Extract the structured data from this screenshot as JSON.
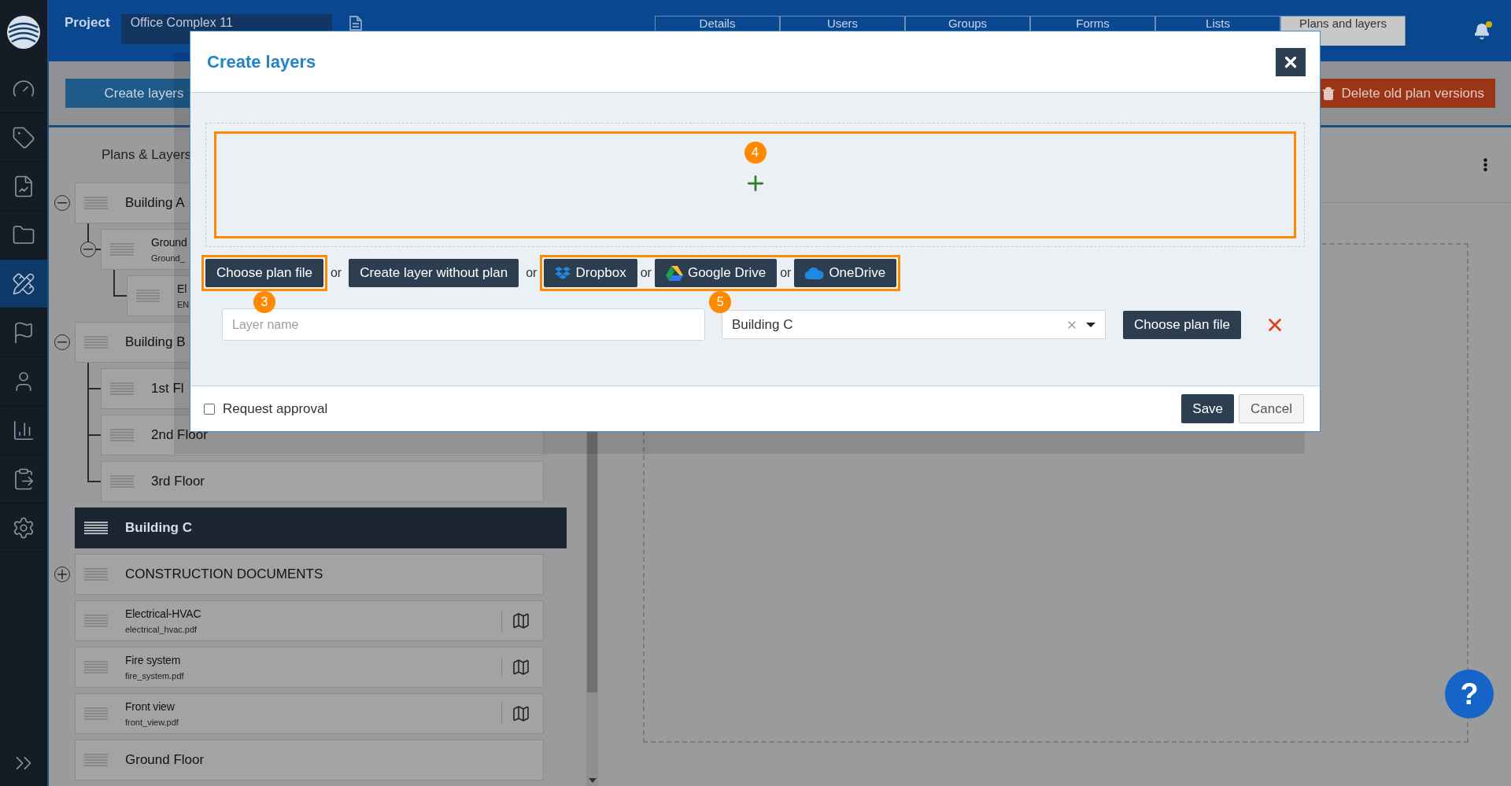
{
  "nav": {
    "items": [
      {
        "kind": "gauge",
        "selected": false
      },
      {
        "kind": "tag",
        "selected": false
      },
      {
        "kind": "report",
        "selected": false
      },
      {
        "kind": "folder",
        "selected": false
      },
      {
        "kind": "tools",
        "selected": true
      },
      {
        "kind": "flag",
        "selected": false
      },
      {
        "kind": "user",
        "selected": false
      },
      {
        "kind": "chart",
        "selected": false
      },
      {
        "kind": "clipboard",
        "selected": false
      },
      {
        "kind": "settings",
        "selected": false
      }
    ]
  },
  "topbar": {
    "project_label": "Project",
    "project_value": "Office Complex 11",
    "tabs": [
      {
        "label": "Details",
        "selected": false
      },
      {
        "label": "Users",
        "selected": false
      },
      {
        "label": "Groups",
        "selected": false
      },
      {
        "label": "Forms",
        "selected": false
      },
      {
        "label": "Lists",
        "selected": false
      },
      {
        "label": "Plans and layers",
        "selected": true
      }
    ]
  },
  "toolbar": {
    "create_button": "Create layers",
    "delete_button": "Delete old plan versions"
  },
  "tree": {
    "title": "Plans & Layers",
    "items": [
      {
        "title": "Building A",
        "expanded": true,
        "selected": false,
        "children": [
          {
            "title": "Ground",
            "subtitle": "Ground_",
            "expanded": true,
            "selected": false,
            "children": [
              {
                "title": "El",
                "subtitle": "EN",
                "selected": false
              }
            ]
          }
        ]
      },
      {
        "title": "Building B",
        "expanded": true,
        "selected": false,
        "children": [
          {
            "title": "1st Fl",
            "selected": false
          },
          {
            "title": "2nd Floor",
            "selected": false
          },
          {
            "title": "3rd Floor",
            "selected": false
          }
        ]
      },
      {
        "title": "Building C",
        "selected": true
      },
      {
        "title": "CONSTRUCTION DOCUMENTS",
        "expanded": false,
        "selected": false
      },
      {
        "title": "Electrical-HVAC",
        "subtitle": "electrical_hvac.pdf",
        "has_plan": true,
        "selected": false
      },
      {
        "title": "Fire system",
        "subtitle": "fire_system.pdf",
        "has_plan": true,
        "selected": false
      },
      {
        "title": "Front view",
        "subtitle": "front_view.pdf",
        "has_plan": true,
        "selected": false
      },
      {
        "title": "Ground Floor",
        "selected": false
      }
    ]
  },
  "modal": {
    "title": "Create layers",
    "drop_zone": {
      "callout": "4"
    },
    "actions": [
      {
        "kind": "button",
        "label": "Choose plan file",
        "highlighted": true,
        "callout": "3"
      },
      {
        "kind": "separator",
        "label": "or"
      },
      {
        "kind": "button",
        "label": "Create layer without plan",
        "highlighted": false
      },
      {
        "kind": "separator",
        "label": "or"
      },
      {
        "kind": "group",
        "callout": "5",
        "items": [
          {
            "kind": "dropbox",
            "label": "Dropbox"
          },
          {
            "kind": "separator",
            "label": "or"
          },
          {
            "kind": "gdrive",
            "label": "Google Drive"
          },
          {
            "kind": "separator",
            "label": "or"
          },
          {
            "kind": "onedrive",
            "label": "OneDrive"
          }
        ]
      }
    ],
    "layer_row": {
      "name_placeholder": "Layer name",
      "parent_value": "Building C",
      "choose_button": "Choose plan file"
    },
    "footer": {
      "request_approval": {
        "label": "Request approval",
        "checked": false
      },
      "save": "Save",
      "cancel": "Cancel"
    }
  },
  "help_button": "?"
}
